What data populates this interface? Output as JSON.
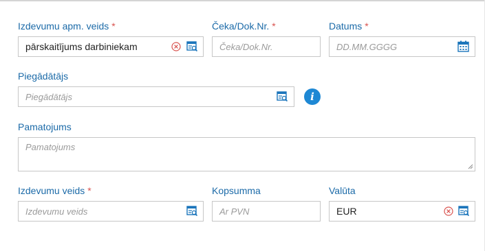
{
  "form": {
    "expense_report_type": {
      "label": "Izdevumu apm. veids",
      "required_mark": "*",
      "value": "pārskaitījums darbiniekam"
    },
    "receipt_number": {
      "label": "Čeka/Dok.Nr.",
      "required_mark": "*",
      "placeholder": "Čeka/Dok.Nr."
    },
    "date": {
      "label": "Datums",
      "required_mark": "*",
      "placeholder": "DD.MM.GGGG"
    },
    "supplier": {
      "label": "Piegādātājs",
      "placeholder": "Piegādātājs"
    },
    "justification": {
      "label": "Pamatojums",
      "placeholder": "Pamatojums"
    },
    "expense_type": {
      "label": "Izdevumu veids",
      "required_mark": "*",
      "placeholder": "Izdevumu veids"
    },
    "total": {
      "label": "Kopsumma",
      "placeholder": "Ar PVN"
    },
    "currency": {
      "label": "Valūta",
      "value": "EUR"
    }
  },
  "icons": {
    "clear": "clear-icon",
    "lookup": "lookup-list-icon",
    "calendar": "calendar-icon",
    "info": "info-icon",
    "info_glyph": "i"
  },
  "colors": {
    "label": "#1b6aa8",
    "required": "#d9534f",
    "icon_blue": "#1b75bb",
    "clear_red": "#d9534f",
    "info_bg": "#1e88d4"
  }
}
